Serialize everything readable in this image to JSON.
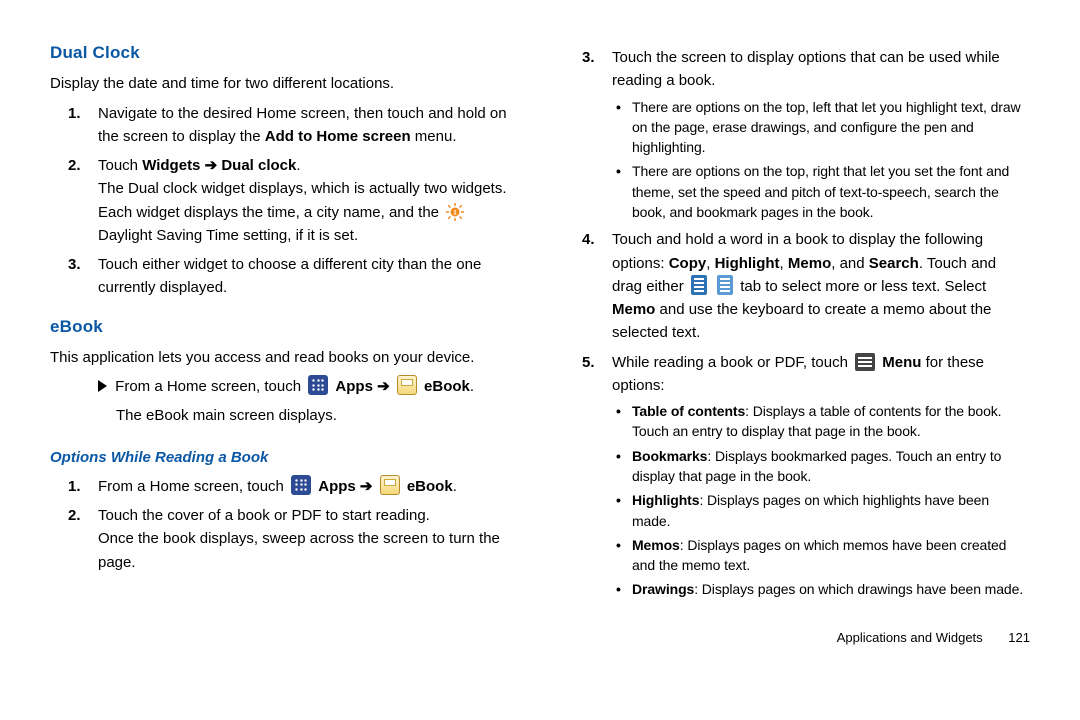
{
  "left": {
    "h_dual_clock": "Dual Clock",
    "dual_clock_intro": "Display the date and time for two different locations.",
    "dc1_a": "Navigate to the desired Home screen, then touch and hold on the screen to display the ",
    "dc1_b_bold": "Add to Home screen",
    "dc1_c": " menu.",
    "dc2_a": "Touch ",
    "dc2_b_bold": "Widgets ",
    "dc2_arrow": "➔",
    "dc2_c_bold": " Dual clock",
    "dc2_d": ".",
    "dc2_body_a": "The Dual clock widget displays, which is actually two widgets. Each widget displays the time, a city name, and the ",
    "dc2_body_b": " Daylight Saving Time setting, if it is set.",
    "dc3": "Touch either widget to choose a different city than the one currently displayed.",
    "h_ebook": "eBook",
    "ebook_intro": "This application lets you access and read books on your device.",
    "eb_step_a": "From a Home screen, touch ",
    "eb_apps_bold": " Apps ",
    "eb_arrow": "➔",
    "eb_ebook_bold": " eBook",
    "eb_step_dot": ".",
    "eb_step_body": "The eBook main screen displays.",
    "h_options": "Options While Reading a Book",
    "op1_a": "From a Home screen, touch ",
    "op2": "Touch the cover of a book or PDF to start reading.",
    "op2_body": "Once the book displays, sweep across the screen to turn the page."
  },
  "right": {
    "r3": "Touch the screen to display options that can be used while reading a book.",
    "r3b1": "There are options on the top, left that let you highlight text, draw on the page, erase drawings, and configure the pen and highlighting.",
    "r3b2": "There are options on the top, right that let you set the font and theme, set the speed and pitch of text-to-speech, search the book, and bookmark pages in the book.",
    "r4_a": "Touch and hold a word in a book to display the following options: ",
    "r4_copy": "Copy",
    "r4_hl": "Highlight",
    "r4_memo": "Memo",
    "r4_search": "Search",
    "r4_b": ". Touch and drag either ",
    "r4_c": " tab to select more or less text. Select ",
    "r4_memo2": "Memo",
    "r4_d": " and use the keyboard to create a memo about the selected text.",
    "r5_a": "While reading a book or PDF, touch ",
    "r5_menu": " Menu",
    "r5_b": " for these options:",
    "r5_toc_b": "Table of contents",
    "r5_toc": ": Displays a table of contents for the book. Touch an entry to display that page in the book.",
    "r5_bm_b": "Bookmarks",
    "r5_bm": ": Displays bookmarked pages. Touch an entry to display that page in the book.",
    "r5_hl_b": "Highlights",
    "r5_hl": ": Displays pages on which highlights have been made.",
    "r5_me_b": "Memos",
    "r5_me": ": Displays pages on which memos have been created and the memo text.",
    "r5_dr_b": "Drawings",
    "r5_dr": ": Displays pages on which drawings have been made."
  },
  "footer": {
    "section": "Applications and Widgets",
    "page": "121"
  }
}
